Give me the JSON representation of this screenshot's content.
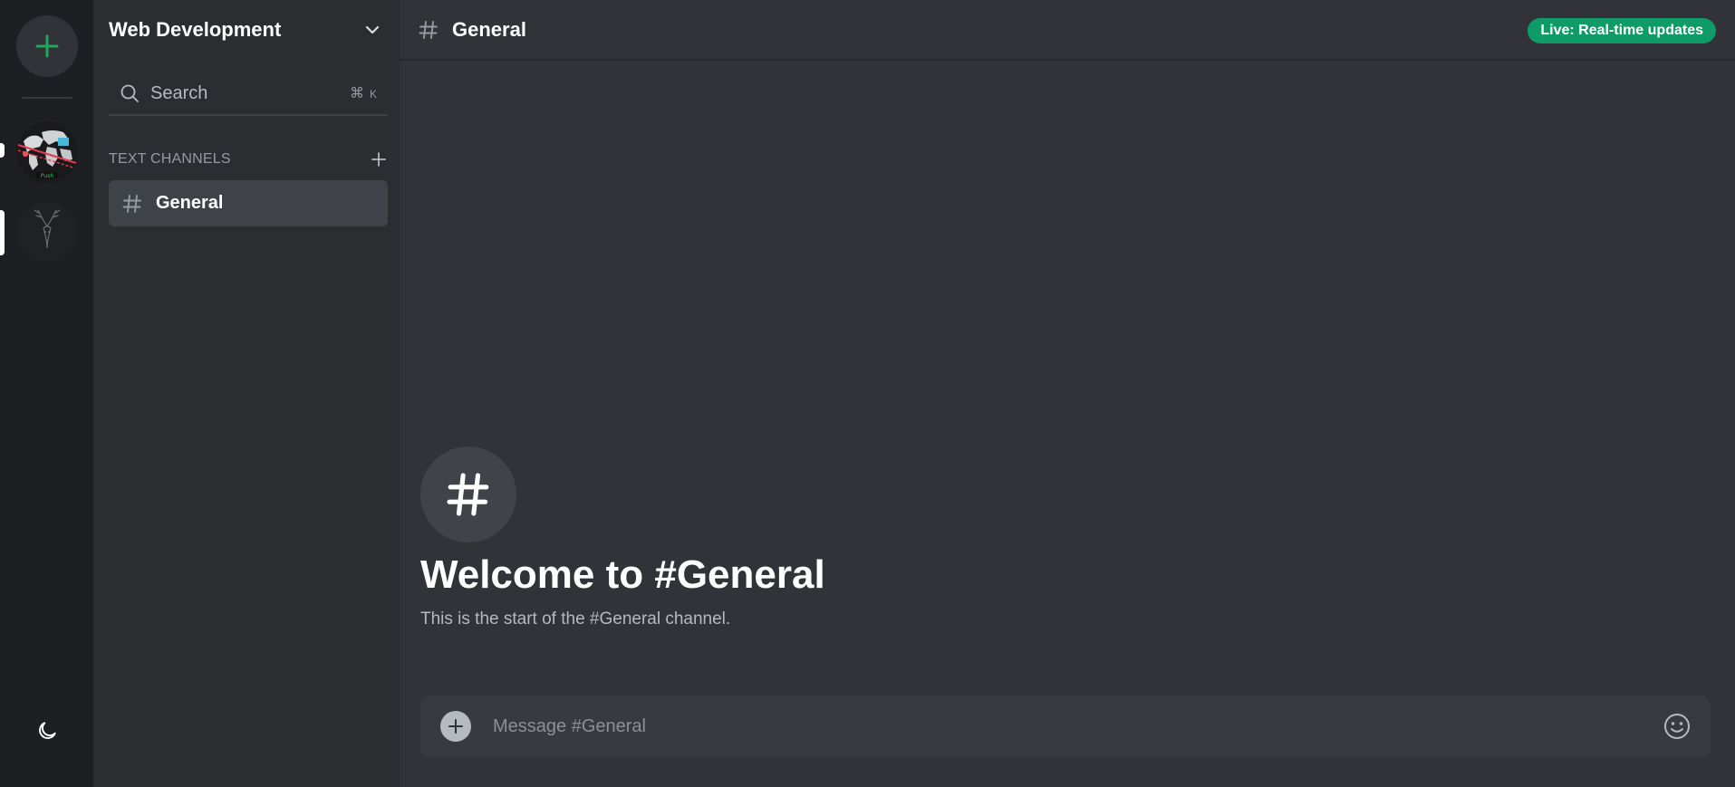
{
  "server": {
    "name": "Web Development"
  },
  "search": {
    "label": "Search",
    "shortcut_symbol": "⌘",
    "shortcut_key": "K"
  },
  "sidebar": {
    "category_label": "TEXT CHANNELS",
    "channels": [
      {
        "label": "General",
        "active": true
      }
    ]
  },
  "channel": {
    "title": "General"
  },
  "status": {
    "live_badge": "Live: Real-time updates"
  },
  "welcome": {
    "title": "Welcome to #General",
    "subtitle": "This is the start of the #General channel."
  },
  "composer": {
    "placeholder": "Message #General"
  },
  "icons": {
    "add_server": "plus-icon",
    "theme_toggle": "moon-icon",
    "dropdown": "chevron-down-icon",
    "search": "search-icon",
    "category_add": "plus-icon",
    "channel": "hash-icon",
    "composer_add": "plus-circle-icon",
    "emoji": "smiley-icon"
  },
  "colors": {
    "accent_green": "#23a55a",
    "live_badge_bg": "#0f9b68",
    "rail_bg": "#1e1f22",
    "sidebar_bg": "#2b2d31",
    "main_bg": "#313338"
  }
}
